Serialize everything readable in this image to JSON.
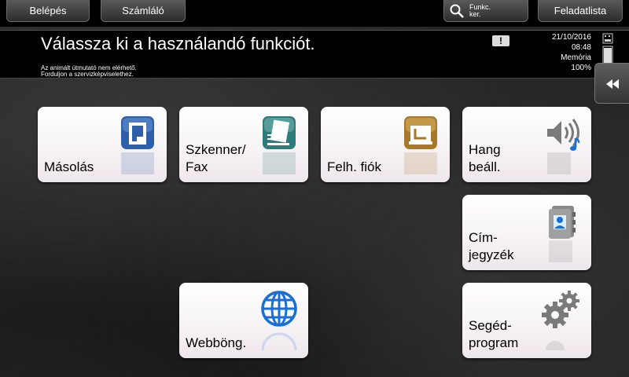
{
  "topbar": {
    "login_label": "Belépés",
    "counter_label": "Számláló",
    "search_label": "Funkc.\nker.",
    "joblist_label": "Feladatlista"
  },
  "message": {
    "title": "Válassza ki a használandó funkciót.",
    "subtitle": "Az animált útmutató nem elérhető.\nForduljon a szervizképviselethez.",
    "warning_icon": "warning-icon"
  },
  "status": {
    "date": "21/10/2016",
    "time": "08:48",
    "memory_label": "Memória",
    "memory_value": "100%"
  },
  "tiles": {
    "copy": {
      "label": "Másolás",
      "icon": "copy-icon",
      "color": "#2f5fa8"
    },
    "scan": {
      "label": "Szkenner/\nFax",
      "icon": "scan-fax-icon",
      "color": "#2e7b7b"
    },
    "userbox": {
      "label": "Felh. fiók",
      "icon": "user-box-icon",
      "color": "#a8782a"
    },
    "sound": {
      "label": "Hang\nbeáll.",
      "icon": "sound-icon"
    },
    "address": {
      "label": "Cím-\njegyzék",
      "icon": "address-book-icon"
    },
    "web": {
      "label": "Webböng.",
      "icon": "globe-icon",
      "color": "#1a6fd6"
    },
    "utility": {
      "label": "Segéd-\nprogram",
      "icon": "gears-icon"
    }
  }
}
